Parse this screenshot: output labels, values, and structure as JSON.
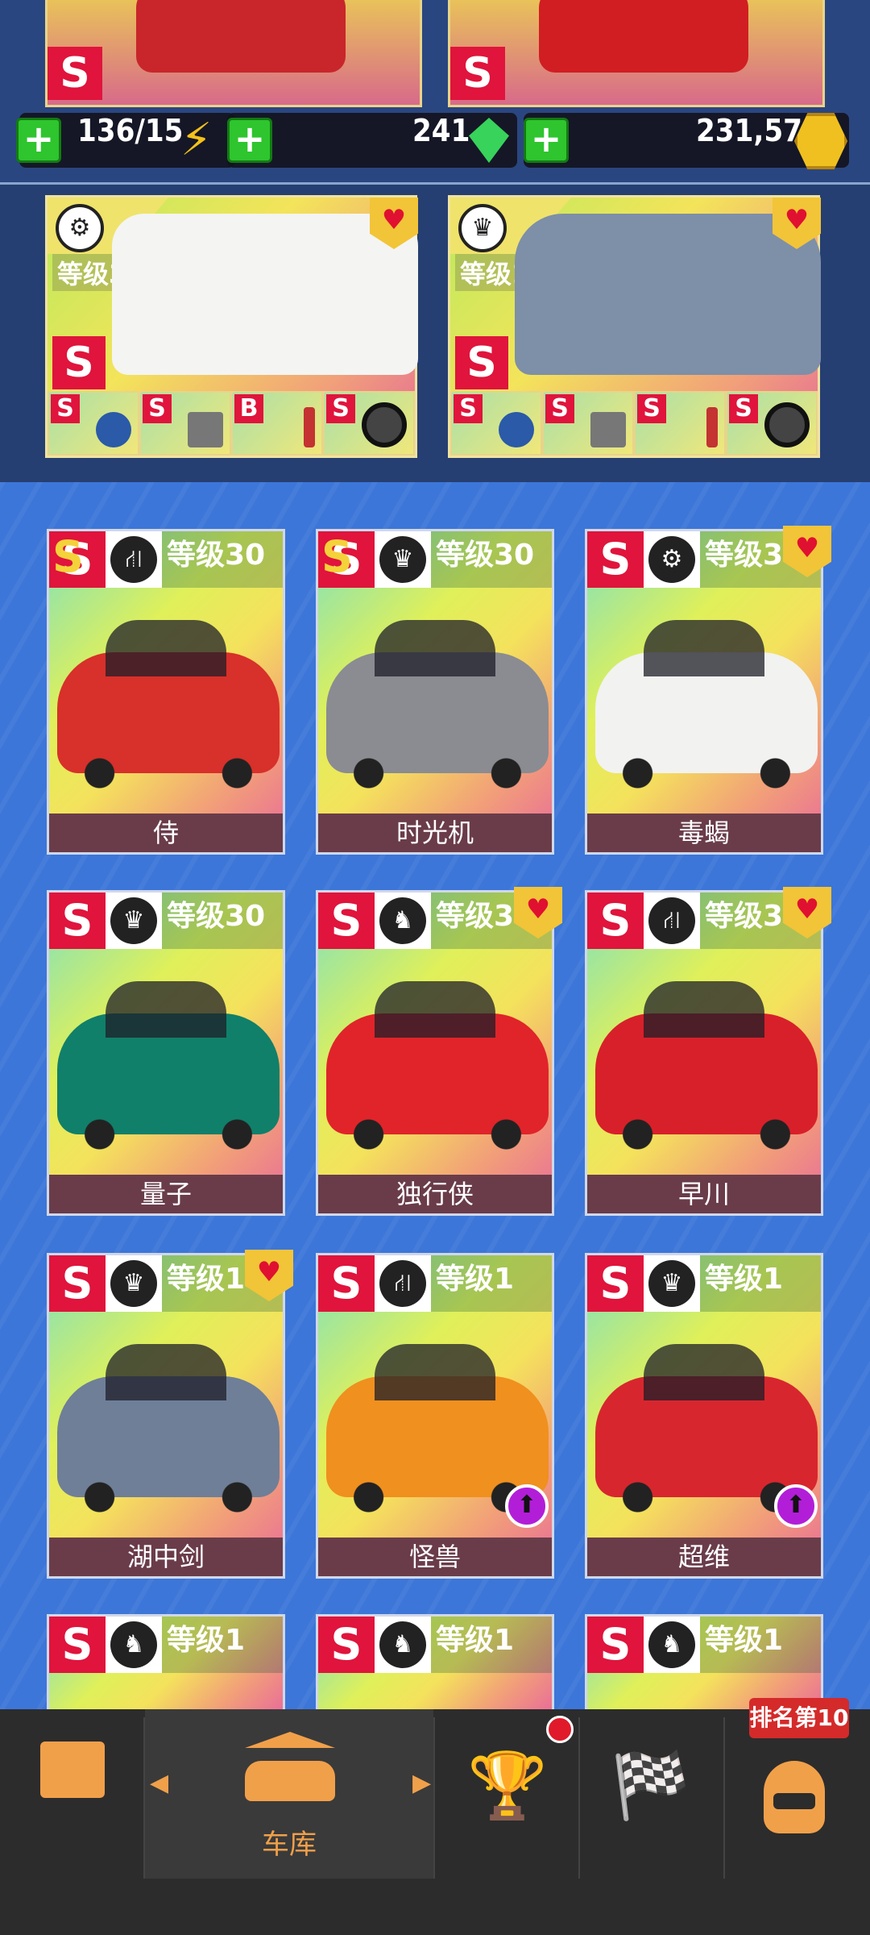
{
  "resources": {
    "fuel": "136/15",
    "gems": "241",
    "coins": "231,576"
  },
  "top_cards": [
    {
      "grade": "S"
    },
    {
      "grade": "S"
    }
  ],
  "favorites": [
    {
      "level": "等级30",
      "grade": "S",
      "class_icon": "tire-icon",
      "parts": [
        {
          "grade": "S",
          "note": "4 2"
        },
        {
          "grade": "S"
        },
        {
          "grade": "B"
        },
        {
          "grade": "S"
        }
      ]
    },
    {
      "level": "等级19",
      "grade": "S",
      "class_icon": "crown-icon",
      "parts": [
        {
          "grade": "S",
          "note": "4 2"
        },
        {
          "grade": "S"
        },
        {
          "grade": "S"
        },
        {
          "grade": "S"
        }
      ]
    }
  ],
  "cars": [
    {
      "name": "侍",
      "level": "等级30",
      "grade": "SS",
      "class_icon": "road-icon"
    },
    {
      "name": "时光机",
      "level": "等级30",
      "grade": "SS",
      "class_icon": "crown-icon"
    },
    {
      "name": "毒蝎",
      "level": "等级3",
      "grade": "S",
      "class_icon": "tire-icon"
    },
    {
      "name": "量子",
      "level": "等级30",
      "grade": "S",
      "class_icon": "crown-icon"
    },
    {
      "name": "独行侠",
      "level": "等级3",
      "grade": "S",
      "class_icon": "horse-icon"
    },
    {
      "name": "早川",
      "level": "等级3",
      "grade": "S",
      "class_icon": "road-icon"
    },
    {
      "name": "湖中剑",
      "level": "等级1",
      "grade": "S",
      "class_icon": "crown-icon"
    },
    {
      "name": "怪兽",
      "level": "等级1",
      "grade": "S",
      "class_icon": "road-icon"
    },
    {
      "name": "超维",
      "level": "等级1",
      "grade": "S",
      "class_icon": "crown-icon"
    },
    {
      "name": "",
      "level": "等级1",
      "grade": "S",
      "class_icon": "horse-icon"
    },
    {
      "name": "",
      "level": "等级1",
      "grade": "S",
      "class_icon": "horse-icon"
    },
    {
      "name": "",
      "level": "等级1",
      "grade": "S",
      "class_icon": "horse-icon"
    }
  ],
  "nav": {
    "garage_label": "车库",
    "rank_badge": "排名第10"
  },
  "colors": {
    "grade_red": "#e0143c",
    "accent_orange": "#f1a04a",
    "heart_gold": "#f2c438"
  }
}
